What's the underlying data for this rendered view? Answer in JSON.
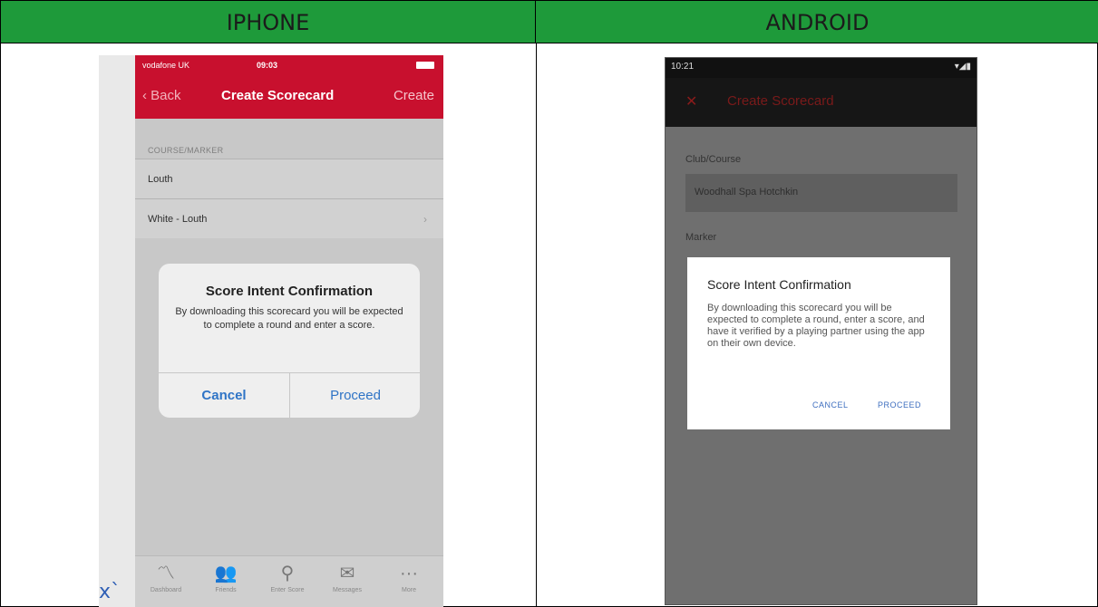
{
  "table": {
    "header_left": "IPHONE",
    "header_right": "ANDROID",
    "header_color": "#1e9a3a"
  },
  "iphone": {
    "status": {
      "carrier": "vodafone UK",
      "time": "09:03"
    },
    "nav": {
      "back_label": "Back",
      "title": "Create Scorecard",
      "create_label": "Create"
    },
    "section_label": "COURSE/MARKER",
    "rows": [
      {
        "label": "Louth"
      },
      {
        "label": "White - Louth"
      }
    ],
    "alert": {
      "title": "Score Intent Confirmation",
      "message": "By downloading this scorecard you will be expected to complete a round and enter a score.",
      "cancel_label": "Cancel",
      "proceed_label": "Proceed"
    },
    "tabs": [
      {
        "label": "Dashboard",
        "icon": "chart-icon"
      },
      {
        "label": "Friends",
        "icon": "friends-icon"
      },
      {
        "label": "Enter Score",
        "icon": "pin-icon"
      },
      {
        "label": "Messages",
        "icon": "mail-icon"
      },
      {
        "label": "More",
        "icon": "more-icon"
      }
    ],
    "accent": "#c8102e",
    "button_color": "#2f74c6"
  },
  "stray_text": "x`",
  "android": {
    "status": {
      "time": "10:21"
    },
    "toolbar": {
      "title": "Create Scorecard"
    },
    "club_label": "Club/Course",
    "club_value": "Woodhall Spa Hotchkin",
    "marker_label": "Marker",
    "dialog": {
      "title": "Score Intent Confirmation",
      "message": "By downloading this scorecard you will be expected to complete a round, enter a score, and have it verified by a playing partner using the app on their own device.",
      "cancel_label": "CANCEL",
      "proceed_label": "PROCEED"
    }
  }
}
